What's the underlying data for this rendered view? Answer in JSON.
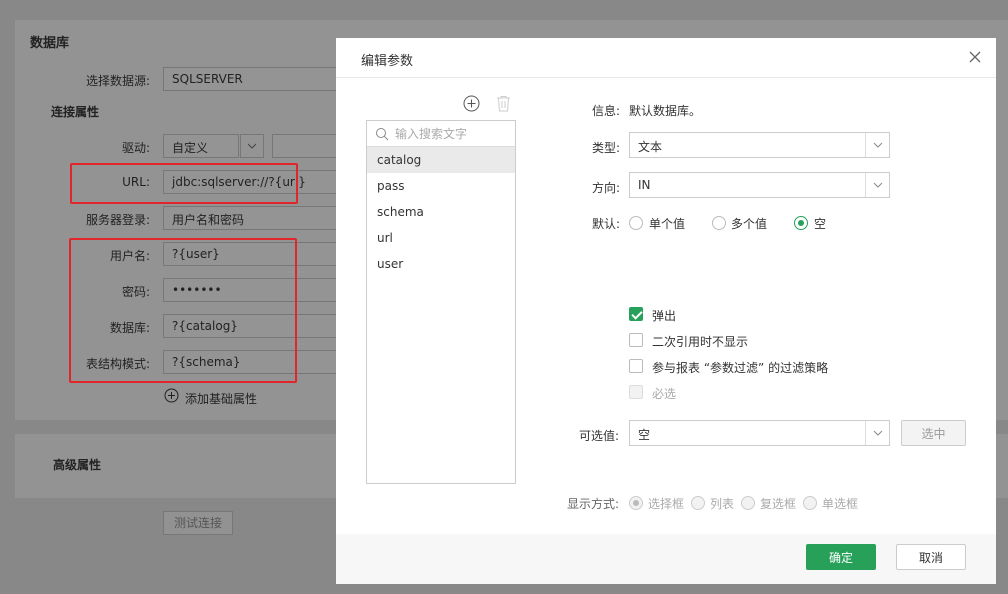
{
  "background": {
    "section_title": "数据库",
    "fields": [
      {
        "label": "选择数据源:",
        "value": "SQLSERVER"
      },
      {
        "label": "驱动:",
        "value": "自定义"
      },
      {
        "label": "URL:",
        "value": "jdbc:sqlserver://?{url}"
      },
      {
        "label": "服务器登录:",
        "value": "用户名和密码"
      },
      {
        "label": "用户名:",
        "value": "?{user}"
      },
      {
        "label": "密码:",
        "value": "•••••••"
      },
      {
        "label": "数据库:",
        "value": "?{catalog}"
      },
      {
        "label": "表结构模式:",
        "value": "?{schema}"
      }
    ],
    "conn_props_title": "连接属性",
    "add_prop_label": "添加基础属性",
    "advanced_title": "高级属性",
    "test_button": "测试连接"
  },
  "dialog": {
    "title": "编辑参数",
    "search_placeholder": "输入搜索文字",
    "params": [
      "catalog",
      "pass",
      "schema",
      "url",
      "user"
    ],
    "selected_param": "catalog",
    "info_label": "信息:",
    "info_value": "默认数据库。",
    "type_label": "类型:",
    "type_value": "文本",
    "direction_label": "方向:",
    "direction_value": "IN",
    "default_label": "默认:",
    "default_options": [
      "单个值",
      "多个值",
      "空"
    ],
    "default_selected": "空",
    "checkboxes": [
      {
        "label": "弹出",
        "checked": true,
        "disabled": false
      },
      {
        "label": "二次引用时不显示",
        "checked": false,
        "disabled": false
      },
      {
        "label": "参与报表 “参数过滤” 的过滤策略",
        "checked": false,
        "disabled": false
      },
      {
        "label": "必选",
        "checked": false,
        "disabled": true
      }
    ],
    "options_label": "可选值:",
    "options_value": "空",
    "select_button": "选中",
    "display_label": "显示方式:",
    "display_options": [
      "选择框",
      "列表",
      "复选框",
      "单选框"
    ],
    "display_selected": "选择框",
    "ok_button": "确定",
    "cancel_button": "取消"
  },
  "colors": {
    "accent": "#27a05a",
    "highlight_box": "#e0262a",
    "overlay": "#888888"
  }
}
